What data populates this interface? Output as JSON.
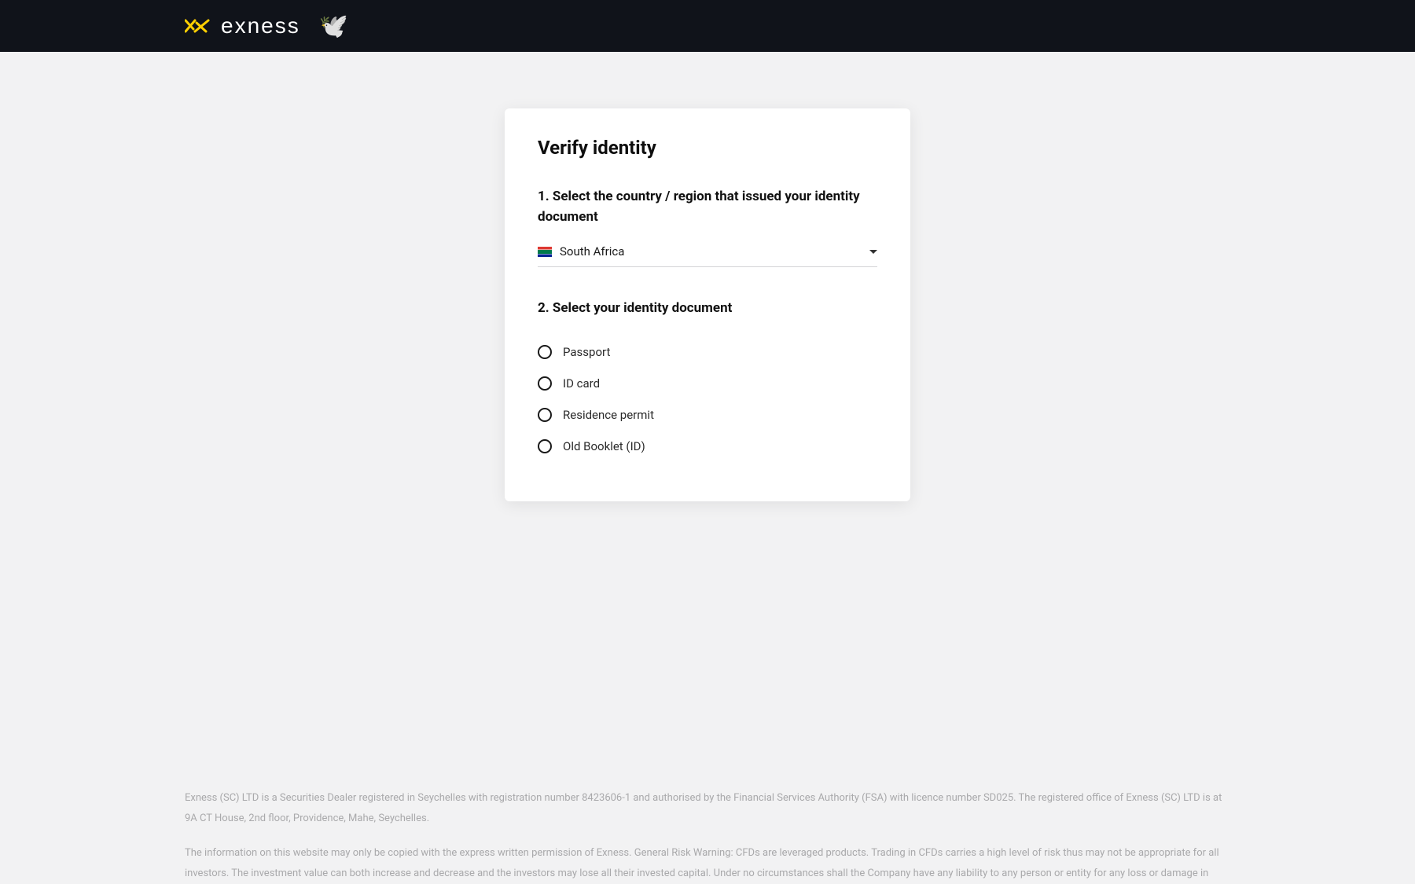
{
  "header": {
    "brand_text": "exness"
  },
  "card": {
    "title": "Verify identity",
    "step1_label": "1. Select the country / region that issued your identity document",
    "country": {
      "name": "South Africa"
    },
    "step2_label": "2. Select your identity document",
    "doc_options": [
      {
        "label": "Passport"
      },
      {
        "label": "ID card"
      },
      {
        "label": "Residence permit"
      },
      {
        "label": "Old Booklet (ID)"
      }
    ]
  },
  "footer": {
    "p1": "Exness (SC) LTD is a Securities Dealer registered in Seychelles with registration number 8423606-1 and authorised by the Financial Services Authority (FSA) with licence number SD025. The registered office of Exness (SC) LTD is at 9A CT House, 2nd floor, Providence, Mahe, Seychelles.",
    "p2": "The information on this website may only be copied with the express written permission of Exness. General Risk Warning: CFDs are leveraged products. Trading in CFDs carries a high level of risk thus may not be appropriate for all investors. The investment value can both increase and decrease and the investors may lose all their invested capital. Under no circumstances shall the Company have any liability to any person or entity for any loss or damage in"
  }
}
